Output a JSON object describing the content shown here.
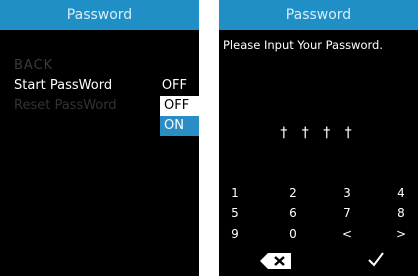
{
  "left": {
    "title": "Password",
    "menu": {
      "back": "BACK",
      "start_label": "Start PassWord",
      "start_value": "OFF",
      "reset_label": "Reset PassWord"
    },
    "dropdown": {
      "options": [
        "OFF",
        "ON"
      ],
      "selected": "ON"
    }
  },
  "right": {
    "title": "Password",
    "prompt": "Please Input Your Password.",
    "masked_input": "† † † †",
    "keypad": [
      "1",
      "2",
      "3",
      "4",
      "5",
      "6",
      "7",
      "8",
      "9",
      "0",
      "<",
      ">"
    ],
    "backspace_icon": "backspace-icon",
    "confirm_icon": "check-icon"
  },
  "colors": {
    "accent": "#1f8fc6",
    "background": "#000000",
    "selected": "#2a8dc4"
  }
}
